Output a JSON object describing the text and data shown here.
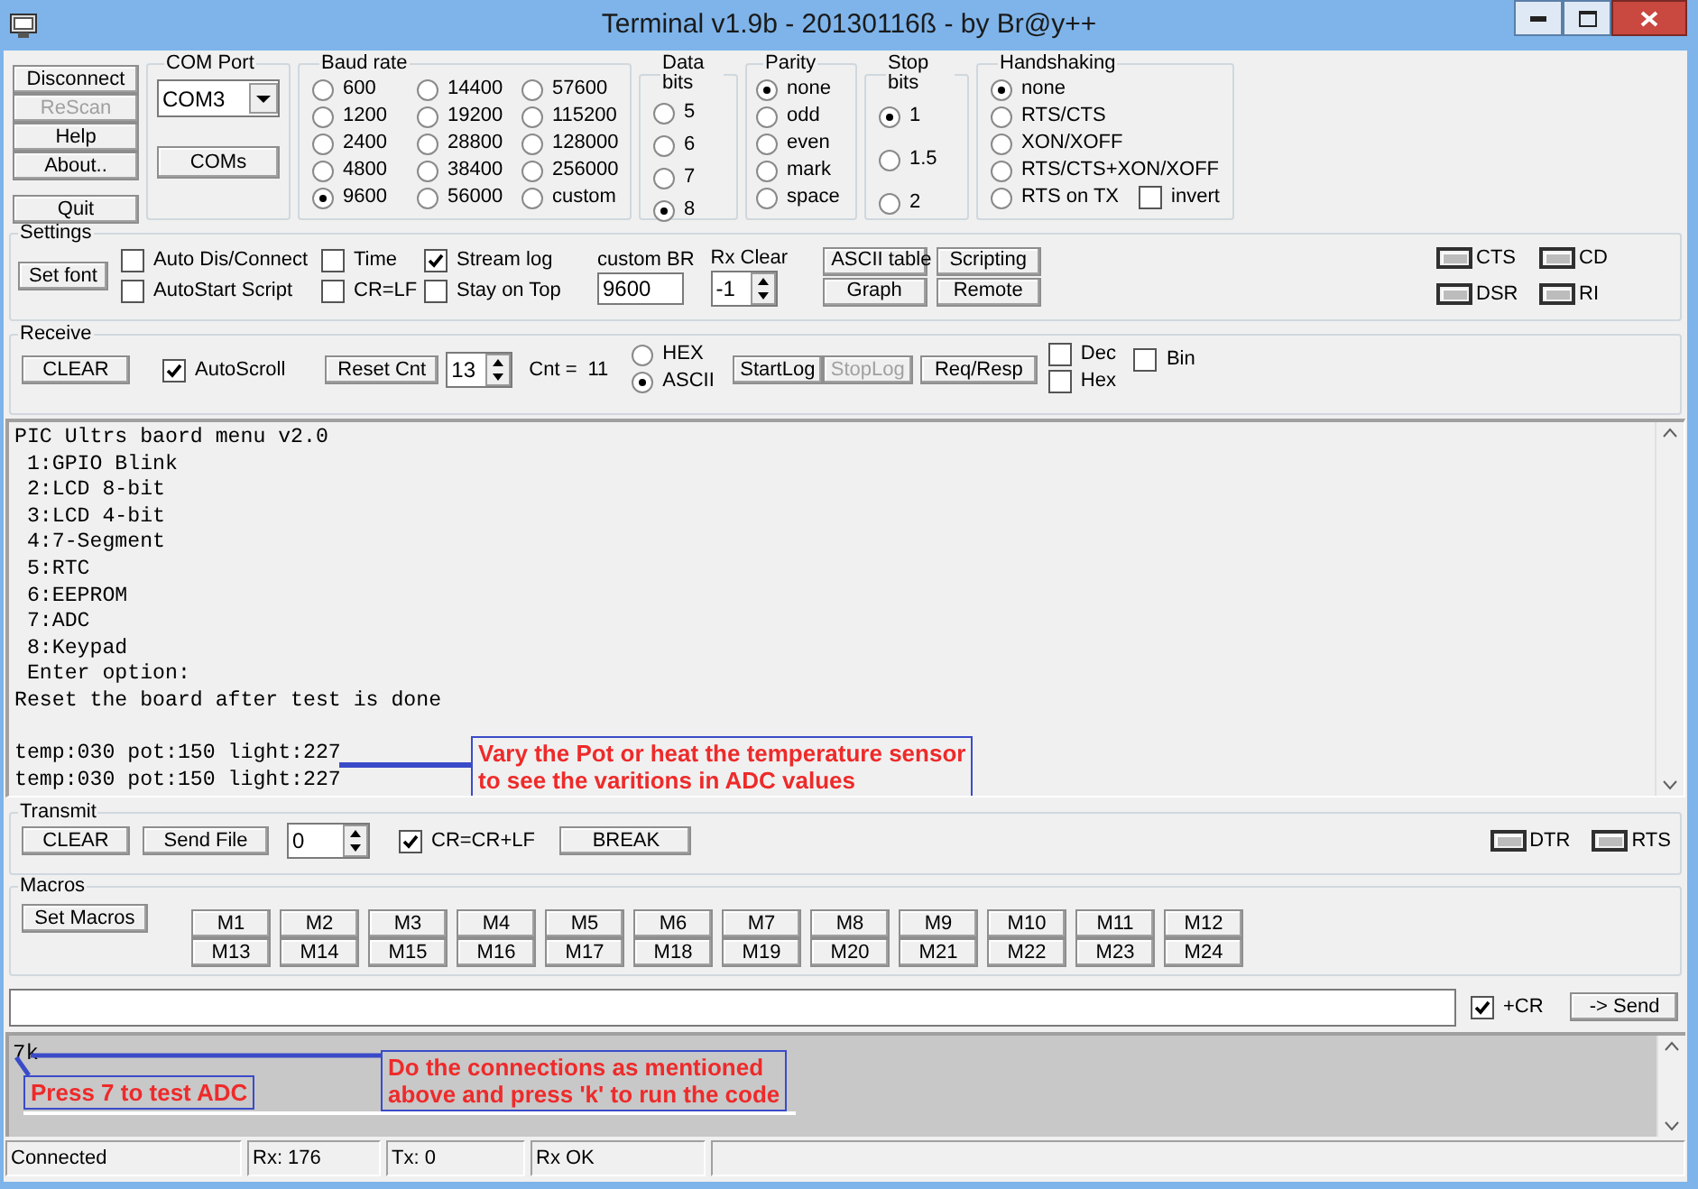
{
  "window": {
    "title": "Terminal v1.9b - 20130116ß - by Br@y++"
  },
  "side_buttons": [
    {
      "label": "Disconnect",
      "disabled": false
    },
    {
      "label": "ReScan",
      "disabled": true
    },
    {
      "label": "Help",
      "disabled": false
    },
    {
      "label": "About..",
      "disabled": false
    },
    {
      "label": "Quit",
      "disabled": false
    }
  ],
  "com_port": {
    "title": "COM Port",
    "value": "COM3",
    "button": "COMs"
  },
  "baud_rate": {
    "title": "Baud rate",
    "options": [
      {
        "label": "600",
        "selected": false
      },
      {
        "label": "1200",
        "selected": false
      },
      {
        "label": "2400",
        "selected": false
      },
      {
        "label": "4800",
        "selected": false
      },
      {
        "label": "9600",
        "selected": true
      },
      {
        "label": "14400",
        "selected": false
      },
      {
        "label": "19200",
        "selected": false
      },
      {
        "label": "28800",
        "selected": false
      },
      {
        "label": "38400",
        "selected": false
      },
      {
        "label": "56000",
        "selected": false
      },
      {
        "label": "57600",
        "selected": false
      },
      {
        "label": "115200",
        "selected": false
      },
      {
        "label": "128000",
        "selected": false
      },
      {
        "label": "256000",
        "selected": false
      },
      {
        "label": "custom",
        "selected": false
      }
    ]
  },
  "data_bits": {
    "title": "Data bits",
    "options": [
      {
        "label": "5",
        "selected": false
      },
      {
        "label": "6",
        "selected": false
      },
      {
        "label": "7",
        "selected": false
      },
      {
        "label": "8",
        "selected": true
      }
    ]
  },
  "parity": {
    "title": "Parity",
    "options": [
      {
        "label": "none",
        "selected": true
      },
      {
        "label": "odd",
        "selected": false
      },
      {
        "label": "even",
        "selected": false
      },
      {
        "label": "mark",
        "selected": false
      },
      {
        "label": "space",
        "selected": false
      }
    ]
  },
  "stop_bits": {
    "title": "Stop bits",
    "options": [
      {
        "label": "1",
        "selected": true
      },
      {
        "label": "1.5",
        "selected": false
      },
      {
        "label": "2",
        "selected": false
      }
    ]
  },
  "handshaking": {
    "title": "Handshaking",
    "options": [
      {
        "label": "none",
        "selected": true
      },
      {
        "label": "RTS/CTS",
        "selected": false
      },
      {
        "label": "XON/XOFF",
        "selected": false
      },
      {
        "label": "RTS/CTS+XON/XOFF",
        "selected": false
      },
      {
        "label": "RTS on TX",
        "selected": false
      }
    ],
    "invert": {
      "label": "invert",
      "checked": false
    }
  },
  "settings": {
    "title": "Settings",
    "set_font": "Set font",
    "checkboxes": [
      {
        "label": "Auto Dis/Connect",
        "checked": false
      },
      {
        "label": "AutoStart Script",
        "checked": false
      },
      {
        "label": "Time",
        "checked": false
      },
      {
        "label": "CR=LF",
        "checked": false
      },
      {
        "label": "Stream log",
        "checked": true
      },
      {
        "label": "Stay on Top",
        "checked": false
      }
    ],
    "custom_br": {
      "label": "custom BR",
      "value": "9600"
    },
    "rx_clear": {
      "label": "Rx Clear",
      "value": "-1"
    },
    "buttons": [
      "ASCII table",
      "Scripting",
      "Graph",
      "Remote"
    ],
    "indicators": [
      {
        "label": "CTS",
        "on": false
      },
      {
        "label": "CD",
        "on": false
      },
      {
        "label": "DSR",
        "on": false
      },
      {
        "label": "RI",
        "on": false
      }
    ]
  },
  "receive": {
    "title": "Receive",
    "clear": "CLEAR",
    "autoscroll": {
      "label": "AutoScroll",
      "checked": true
    },
    "reset_cnt": "Reset Cnt",
    "count_box": "13",
    "cnt_label": "Cnt =",
    "cnt_value": "11",
    "modes": [
      {
        "label": "HEX",
        "selected": false
      },
      {
        "label": "ASCII",
        "selected": true
      }
    ],
    "buttons": [
      {
        "label": "StartLog",
        "disabled": false
      },
      {
        "label": "StopLog",
        "disabled": true
      },
      {
        "label": "Req/Resp",
        "disabled": false
      }
    ],
    "formats": [
      {
        "label": "Dec",
        "checked": false
      },
      {
        "label": "Hex",
        "checked": false
      },
      {
        "label": "Bin",
        "checked": false
      }
    ]
  },
  "receive_text": "PIC Ultrs baord menu v2.0\n 1:GPIO Blink\n 2:LCD 8-bit\n 3:LCD 4-bit\n 4:7-Segment\n 5:RTC\n 6:EEPROM\n 7:ADC\n 8:Keypad\n Enter option:\nReset the board after test is done\n\ntemp:030 pot:150 light:227\ntemp:030 pot:150 light:227",
  "receive_annotations": [
    {
      "kind": "note",
      "text": "Vary the Pot or heat the temperature sensor\nto see the varitions in ADC values"
    }
  ],
  "transmit": {
    "title": "Transmit",
    "clear": "CLEAR",
    "send_file": "Send File",
    "count_box": "0",
    "cr_lf": {
      "label": "CR=CR+LF",
      "checked": true
    },
    "break": "BREAK",
    "indicators": [
      {
        "label": "DTR",
        "on": false
      },
      {
        "label": "RTS",
        "on": false
      }
    ]
  },
  "macros": {
    "title": "Macros",
    "set_macros": "Set Macros",
    "items": [
      "M1",
      "M2",
      "M3",
      "M4",
      "M5",
      "M6",
      "M7",
      "M8",
      "M9",
      "M10",
      "M11",
      "M12",
      "M13",
      "M14",
      "M15",
      "M16",
      "M17",
      "M18",
      "M19",
      "M20",
      "M21",
      "M22",
      "M23",
      "M24"
    ]
  },
  "send_row": {
    "plus_cr": {
      "label": "+CR",
      "checked": true
    },
    "send": "-> Send"
  },
  "transmit_text": "7k",
  "transmit_annotations": [
    {
      "kind": "note",
      "text": "Press 7 to test ADC"
    },
    {
      "kind": "note",
      "text": "Do the connections as mentioned\nabove and press 'k' to run the code"
    }
  ],
  "status_bar": [
    "Connected",
    "Rx: 176",
    "Tx: 0",
    "Rx OK"
  ]
}
